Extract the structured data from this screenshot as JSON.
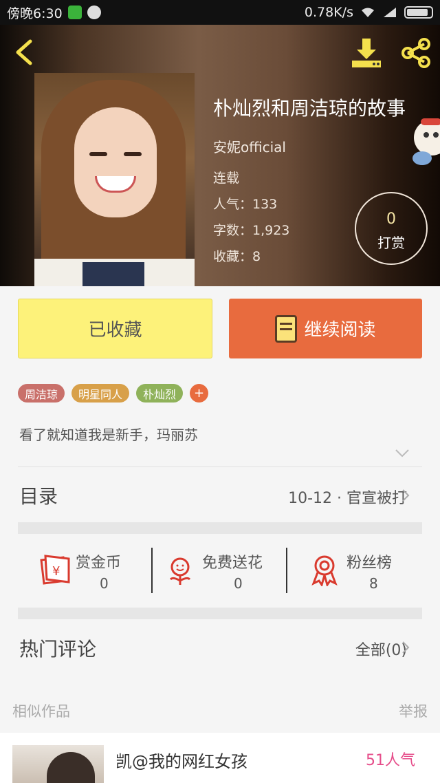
{
  "status_bar": {
    "time": "傍晚6:30",
    "speed": "0.78K/s"
  },
  "book": {
    "title": "朴灿烈和周洁琼的故事",
    "author": "安妮official",
    "status": "连载",
    "popularity": "人气：133",
    "word_count": "字数：1,923",
    "favorites": "收藏：8"
  },
  "tip": {
    "count": "0",
    "label": "打赏"
  },
  "actions": {
    "collected_label": "已收藏",
    "continue_label": "继续阅读"
  },
  "tags": [
    "周洁琼",
    "明星同人",
    "朴灿烈"
  ],
  "tag_add": "+",
  "description": "看了就知道我是新手，玛丽苏",
  "toc": {
    "label": "目录",
    "latest": "10-12 · 官宣被打"
  },
  "stats": [
    {
      "label": "赏金币",
      "value": "0",
      "icon": "coin-envelope-icon"
    },
    {
      "label": "免费送花",
      "value": "0",
      "icon": "flower-icon"
    },
    {
      "label": "粉丝榜",
      "value": "8",
      "icon": "ribbon-badge-icon"
    }
  ],
  "comments": {
    "label": "热门评论",
    "all": "全部(0)"
  },
  "similar": {
    "label": "相似作品",
    "report": "举报",
    "item": {
      "title": "凯@我的网红女孩",
      "popularity": "51人气"
    }
  },
  "colors": {
    "collected_bg": "#fdf27a",
    "continue_bg": "#e86b3e",
    "popularity_pink": "#e64d8a"
  }
}
